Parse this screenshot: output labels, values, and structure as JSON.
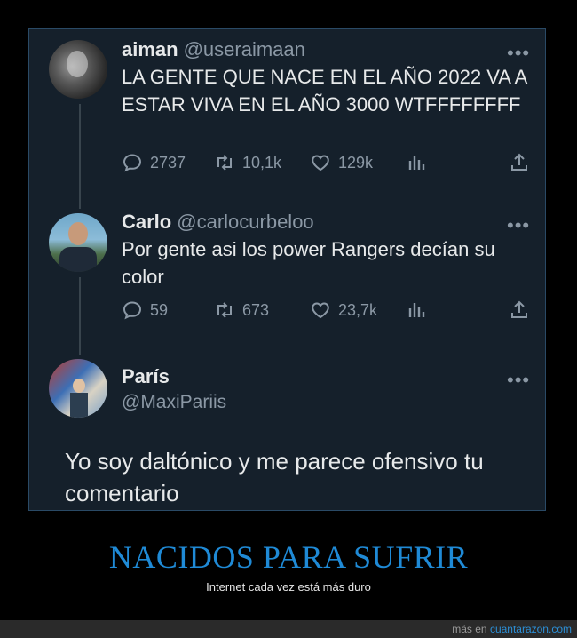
{
  "tweets": [
    {
      "name": "aiman",
      "handle": "@useraimaan",
      "text": "LA GENTE QUE NACE EN EL AÑO 2022 VA A ESTAR VIVA EN EL AÑO 3000 WTFFFFFFFF",
      "replies": "2737",
      "retweets": "10,1k",
      "likes": "129k"
    },
    {
      "name": "Carlo",
      "handle": "@carlocurbeloo",
      "text": "Por gente asi los power Rangers decían su color",
      "replies": "59",
      "retweets": "673",
      "likes": "23,7k"
    },
    {
      "name": "París",
      "handle": "@MaxiPariis",
      "text": "Yo soy daltónico y me parece ofensivo tu comentario"
    }
  ],
  "more_label": "•••",
  "caption": {
    "title": "NACIDOS PARA SUFRIR",
    "subtitle": "Internet cada vez está más duro"
  },
  "footer": {
    "prefix": "más en ",
    "site": "cuantarazon.com"
  },
  "colors": {
    "card_bg": "#15202b",
    "accent": "#1f8ad6",
    "muted": "#8b98a5"
  }
}
